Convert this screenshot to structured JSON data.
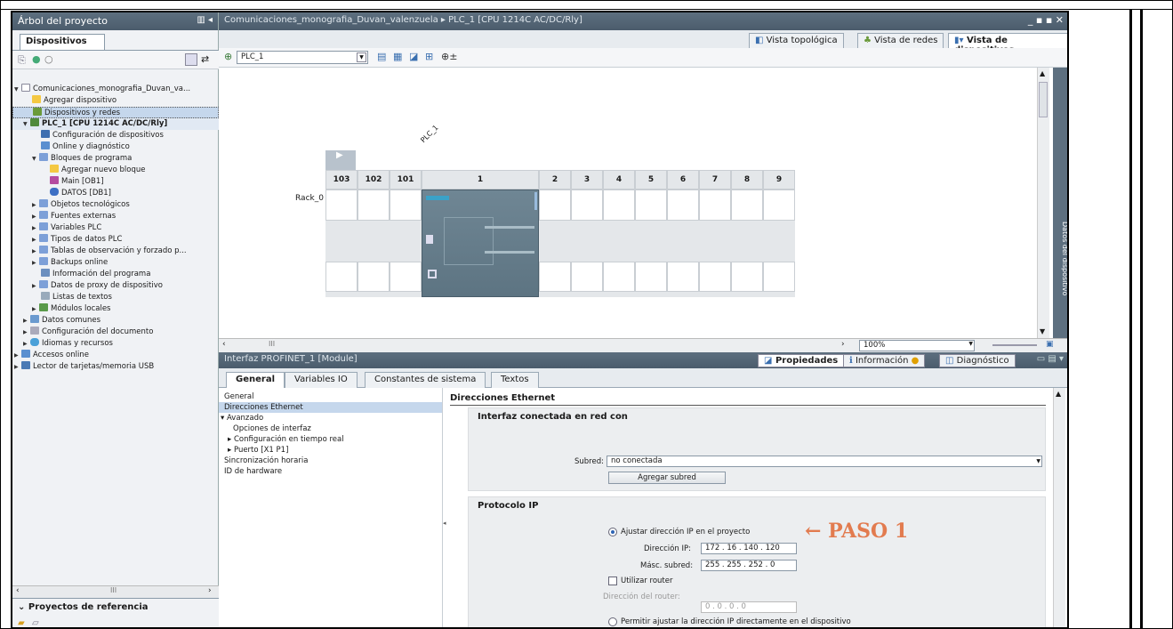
{
  "tree": {
    "title": "Árbol del proyecto",
    "tab": "Dispositivos",
    "items": [
      {
        "label": "Comunicaciones_monografia_Duvan_va...",
        "indent": 0
      },
      {
        "label": "Agregar dispositivo",
        "indent": 1
      },
      {
        "label": "Dispositivos y redes",
        "indent": 1
      },
      {
        "label": "PLC_1 [CPU 1214C AC/DC/Rly]",
        "indent": 1
      },
      {
        "label": "Configuración de dispositivos",
        "indent": 2
      },
      {
        "label": "Online y diagnóstico",
        "indent": 2
      },
      {
        "label": "Bloques de programa",
        "indent": 2
      },
      {
        "label": "Agregar nuevo bloque",
        "indent": 3
      },
      {
        "label": "Main [OB1]",
        "indent": 3
      },
      {
        "label": "DATOS [DB1]",
        "indent": 3
      },
      {
        "label": "Objetos tecnológicos",
        "indent": 2
      },
      {
        "label": "Fuentes externas",
        "indent": 2
      },
      {
        "label": "Variables PLC",
        "indent": 2
      },
      {
        "label": "Tipos de datos PLC",
        "indent": 2
      },
      {
        "label": "Tablas de observación y forzado p...",
        "indent": 2
      },
      {
        "label": "Backups online",
        "indent": 2
      },
      {
        "label": "Información del programa",
        "indent": 2
      },
      {
        "label": "Datos de proxy de dispositivo",
        "indent": 2
      },
      {
        "label": "Listas de textos",
        "indent": 2
      },
      {
        "label": "Módulos locales",
        "indent": 2
      },
      {
        "label": "Datos comunes",
        "indent": 1
      },
      {
        "label": "Configuración del documento",
        "indent": 1
      },
      {
        "label": "Idiomas y recursos",
        "indent": 1
      },
      {
        "label": "Accesos online",
        "indent": 0
      },
      {
        "label": "Lector de tarjetas/memoria USB",
        "indent": 0
      }
    ],
    "bottom_title": "Proyectos de referencia"
  },
  "main": {
    "title": "Comunicaciones_monografia_Duvan_valenzuela  ▸  PLC_1 [CPU 1214C AC/DC/Rly]",
    "tabs": [
      "Vista topológica",
      "Vista de redes",
      "Vista de dispositivos"
    ],
    "device_select": "PLC_1",
    "plc_label": "PLC_1",
    "rack_label": "Rack_0",
    "slots": [
      "103",
      "102",
      "101",
      "1",
      "2",
      "3",
      "4",
      "5",
      "6",
      "7",
      "8",
      "9"
    ],
    "zoom": "100%",
    "side_tab": "Datos del dispositivo"
  },
  "props": {
    "title": "Interfaz PROFINET_1 [Module]",
    "head_tabs": [
      "Propiedades",
      "Información",
      "Diagnóstico"
    ],
    "tabs": [
      "General",
      "Variables IO",
      "Constantes de sistema",
      "Textos"
    ],
    "nav": [
      {
        "label": "General",
        "indent": 0
      },
      {
        "label": "Direcciones Ethernet",
        "indent": 0
      },
      {
        "label": "▾ Avanzado",
        "indent": 0
      },
      {
        "label": "Opciones de interfaz",
        "indent": 1
      },
      {
        "label": "▸ Configuración en tiempo real",
        "indent": 1
      },
      {
        "label": "▸ Puerto [X1 P1]",
        "indent": 1
      },
      {
        "label": "Sincronización horaria",
        "indent": 0
      },
      {
        "label": "ID de hardware",
        "indent": 0
      }
    ],
    "section_title": "Direcciones Ethernet",
    "iface_title": "Interfaz conectada en red con",
    "subnet_label": "Subred:",
    "subnet_value": "no conectada",
    "add_subnet": "Agregar subred",
    "ip_title": "Protocolo IP",
    "radio1": "Ajustar dirección IP en el proyecto",
    "ip_label": "Dirección IP:",
    "ip_value": "172 . 16 . 140 . 120",
    "mask_label": "Másc. subred:",
    "mask_value": "255 . 255 . 252 . 0",
    "router_chk": "Utilizar router",
    "router_label": "Dirección del router:",
    "router_value": "0 . 0 . 0 . 0",
    "radio2": "Permitir ajustar la dirección IP directamente en el dispositivo"
  },
  "annotation": "← PASO 1"
}
